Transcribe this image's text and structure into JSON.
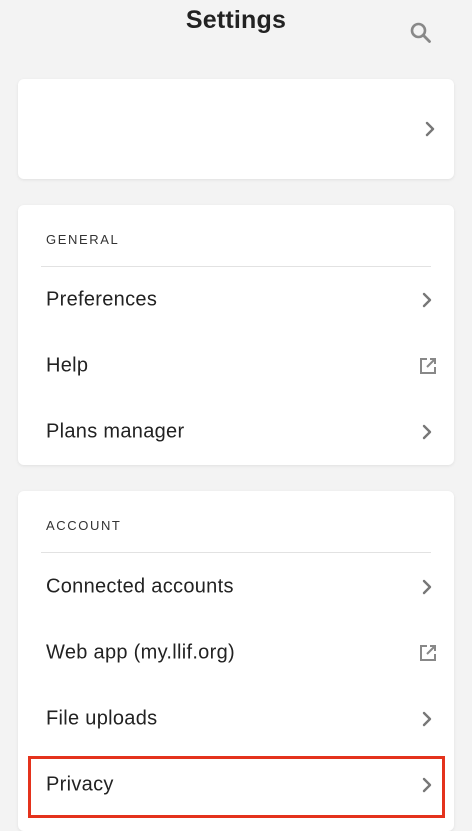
{
  "header": {
    "title": "Settings"
  },
  "general": {
    "section_label": "GENERAL",
    "items": [
      {
        "label": "Preferences",
        "action": "chevron-right-icon"
      },
      {
        "label": "Help",
        "action": "external-link-icon"
      },
      {
        "label": "Plans manager",
        "action": "chevron-right-icon"
      }
    ]
  },
  "account": {
    "section_label": "ACCOUNT",
    "items": [
      {
        "label": "Connected accounts",
        "action": "chevron-right-icon"
      },
      {
        "label": "Web app (my.llif.org)",
        "action": "external-link-icon"
      },
      {
        "label": "File uploads",
        "action": "chevron-right-icon"
      },
      {
        "label": "Privacy",
        "action": "chevron-right-icon"
      }
    ]
  },
  "colors": {
    "background": "#f3f3f3",
    "card": "#ffffff",
    "highlight": "#e4321c",
    "icon": "#888888"
  }
}
